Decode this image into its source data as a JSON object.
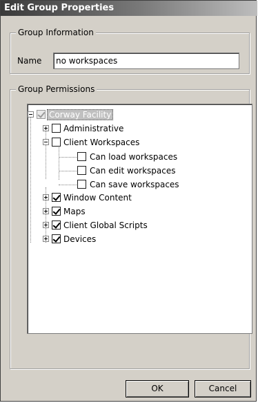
{
  "window": {
    "title": "Edit Group Properties"
  },
  "group_info": {
    "legend": "Group Information",
    "name_label": "Name",
    "name_value": "no workspaces"
  },
  "group_permissions": {
    "legend": "Group Permissions",
    "tree": {
      "root": {
        "label": "Corway Facility",
        "checked": true,
        "disabled": true,
        "selected": true,
        "expanded": true
      },
      "items": [
        {
          "label": "Administrative",
          "checked": false,
          "expander": "plus"
        },
        {
          "label": "Client Workspaces",
          "checked": false,
          "expander": "minus",
          "children": [
            {
              "label": "Can load workspaces",
              "checked": false
            },
            {
              "label": "Can edit workspaces",
              "checked": false
            },
            {
              "label": "Can save workspaces",
              "checked": false
            }
          ]
        },
        {
          "label": "Window Content",
          "checked": true,
          "expander": "plus"
        },
        {
          "label": "Maps",
          "checked": true,
          "expander": "plus"
        },
        {
          "label": "Client Global Scripts",
          "checked": true,
          "expander": "plus"
        },
        {
          "label": "Devices",
          "checked": true,
          "expander": "plus"
        }
      ]
    }
  },
  "buttons": {
    "ok": "OK",
    "cancel": "Cancel"
  }
}
